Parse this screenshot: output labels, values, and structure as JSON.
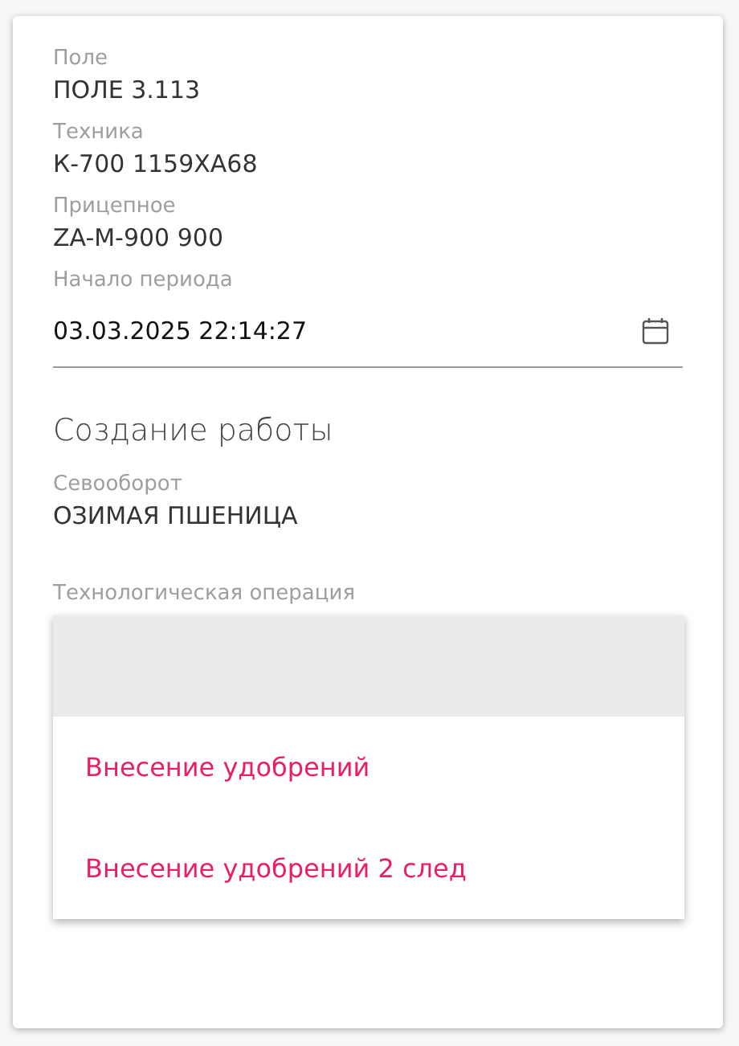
{
  "fields": [
    {
      "label": "Поле",
      "value": "ПОЛЕ 3.113"
    },
    {
      "label": "Техника",
      "value": "К-700 1159ХА68"
    },
    {
      "label": "Прицепное",
      "value": "ZA-M-900 900"
    }
  ],
  "period_start": {
    "label": "Начало периода",
    "value": "03.03.2025 22:14:27"
  },
  "section_title": "Создание работы",
  "crop_rotation": {
    "label": "Севооборот",
    "value": "ОЗИМАЯ ПШЕНИЦА"
  },
  "operation": {
    "label": "Технологическая операция",
    "blank_option_highlighted": true,
    "options": [
      {
        "label": "Внесение удобрений",
        "selected": false
      },
      {
        "label": "Внесение удобрений 2 след",
        "selected": false
      }
    ]
  }
}
